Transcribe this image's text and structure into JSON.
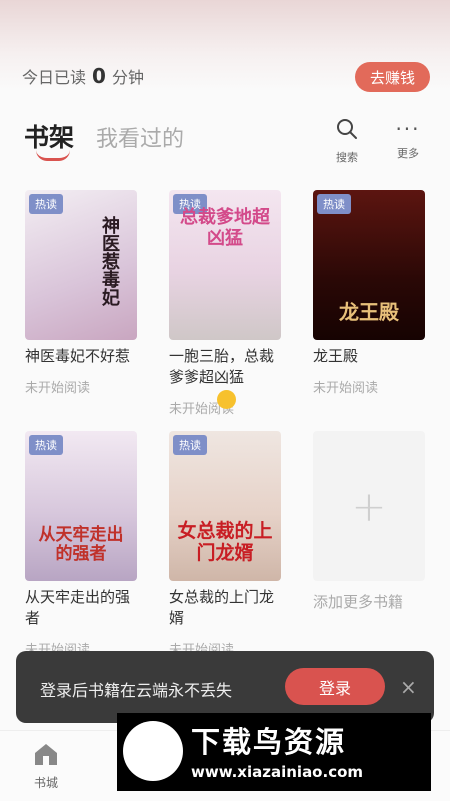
{
  "header": {
    "reading_prefix": "今日已读",
    "reading_minutes": "0",
    "reading_suffix": "分钟",
    "earn_label": "去赚钱"
  },
  "tabs": {
    "shelf": "书架",
    "history": "我看过的"
  },
  "toolbar": {
    "search_label": "搜索",
    "more_label": "更多"
  },
  "books": [
    {
      "badge": "热读",
      "cover_text": "神医惹毒妃",
      "title": "神医毒妃不好惹",
      "status": "未开始阅读"
    },
    {
      "badge": "热读",
      "cover_text": "总裁爹地超凶猛",
      "title": "一胞三胎，总裁爹爹超凶猛",
      "status": "未开始阅读"
    },
    {
      "badge": "热读",
      "cover_text": "龙王殿",
      "title": "龙王殿",
      "status": "未开始阅读"
    },
    {
      "badge": "热读",
      "cover_text": "从天牢走出的强者",
      "title": "从天牢走出的强者",
      "status": "未开始阅读"
    },
    {
      "badge": "热读",
      "cover_text": "女总裁的上门龙婿",
      "title": "女总裁的上门龙婿",
      "status": "未开始阅读"
    }
  ],
  "add_more_label": "添加更多书籍",
  "login_banner": {
    "text": "登录后书籍在云端永不丢失",
    "button": "登录",
    "close": "×"
  },
  "bottom_nav": {
    "bookstore": "书城"
  },
  "watermark": {
    "text": "下载鸟资源",
    "url": "www.xiazainiao.com"
  },
  "colors": {
    "accent": "#d9534f",
    "badge": "#7f8fc8",
    "touch_dot": "#f7c12d"
  }
}
